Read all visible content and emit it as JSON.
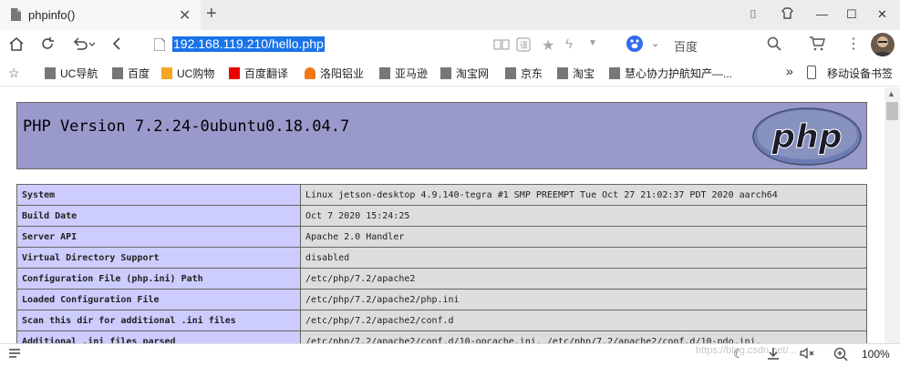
{
  "tab": {
    "title": "phpinfo()",
    "close": "✕",
    "new": "+"
  },
  "window": {
    "minimize": "—",
    "maximize": "☐",
    "close": "✕",
    "extra1": "⌷",
    "extra2": "♜"
  },
  "nav": {
    "url": "192.168.119.210/hello.php",
    "search_engine": "百度"
  },
  "bookmarks": [
    {
      "label": "UC导航"
    },
    {
      "label": "百度"
    },
    {
      "label": "UC购物"
    },
    {
      "label": "百度翻译"
    },
    {
      "label": "洛阳铝业"
    },
    {
      "label": "亚马逊"
    },
    {
      "label": "淘宝网"
    },
    {
      "label": "京东"
    },
    {
      "label": "淘宝"
    },
    {
      "label": "慧心协力护航知产—..."
    }
  ],
  "bookmarks_more": "»",
  "mobile_bookmarks": "移动设备书签",
  "php": {
    "version_title": "PHP Version 7.2.24-0ubuntu0.18.04.7",
    "logo_text": "php"
  },
  "info_rows": [
    {
      "key": "System",
      "value": "Linux jetson-desktop 4.9.140-tegra #1 SMP PREEMPT Tue Oct 27 21:02:37 PDT 2020 aarch64"
    },
    {
      "key": "Build Date",
      "value": "Oct 7 2020 15:24:25"
    },
    {
      "key": "Server API",
      "value": "Apache 2.0 Handler"
    },
    {
      "key": "Virtual Directory Support",
      "value": "disabled"
    },
    {
      "key": "Configuration File (php.ini) Path",
      "value": "/etc/php/7.2/apache2"
    },
    {
      "key": "Loaded Configuration File",
      "value": "/etc/php/7.2/apache2/php.ini"
    },
    {
      "key": "Scan this dir for additional .ini files",
      "value": "/etc/php/7.2/apache2/conf.d"
    },
    {
      "key": "Additional .ini files parsed",
      "value": "/etc/php/7.2/apache2/conf.d/10-opcache.ini, /etc/php/7.2/apache2/conf.d/10-pdo.ini,"
    }
  ],
  "status": {
    "zoom": "100%",
    "watermark": "https://blog.csdn.net/..."
  }
}
